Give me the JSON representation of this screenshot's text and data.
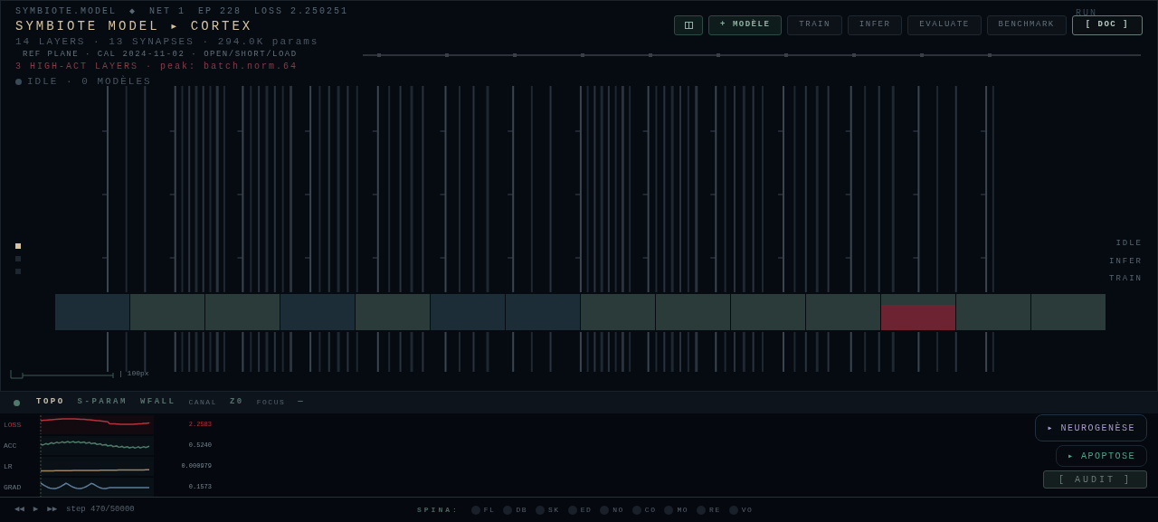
{
  "status_line": {
    "app": "SYMBIOTE.MODEL",
    "separator": "◆",
    "net": "NET 1",
    "epoch": "EP 228",
    "loss": "LOSS 2.250251"
  },
  "title": "SYMBIOTE MODEL ▸ CORTEX",
  "summary": "14 LAYERS · 13 SYNAPSES · 294.0K params",
  "reference": "REF PLANE · CAL 2024-11-02 · OPEN/SHORT/LOAD",
  "alert": "3 HIGH-ACT LAYERS · peak: batch.norm.64",
  "status": {
    "text": "IDLE · 0 MODÈLES"
  },
  "run_label": "RUN",
  "toolbar": [
    {
      "kind": "icon",
      "disabled": false
    },
    {
      "kind": "primary",
      "label": "+ MODÈLE",
      "disabled": false
    },
    {
      "kind": "button",
      "label": "TRAIN",
      "disabled": true
    },
    {
      "kind": "button",
      "label": "INFER",
      "disabled": true
    },
    {
      "kind": "button",
      "label": "EVALUATE",
      "disabled": true
    },
    {
      "kind": "button",
      "label": "BENCHMARK",
      "disabled": true
    },
    {
      "kind": "outline",
      "label": "[ DOC ]",
      "disabled": false
    }
  ],
  "layers": [
    {
      "color": "#1d2d38",
      "hot": false
    },
    {
      "color": "#2a3b39",
      "hot": false
    },
    {
      "color": "#2a3b39",
      "hot": false
    },
    {
      "color": "#1d2d38",
      "hot": false
    },
    {
      "color": "#2a3b39",
      "hot": false
    },
    {
      "color": "#1d2d38",
      "hot": false
    },
    {
      "color": "#1d2d38",
      "hot": false
    },
    {
      "color": "#2a3b39",
      "hot": false
    },
    {
      "color": "#2a3b39",
      "hot": false
    },
    {
      "color": "#2a3b39",
      "hot": false
    },
    {
      "color": "#2a3b39",
      "hot": false
    },
    {
      "color": "#2a3b39",
      "hot": true
    },
    {
      "color": "#2a3b39",
      "hot": false
    },
    {
      "color": "#2a3b39",
      "hot": false
    }
  ],
  "mode_indicators": [
    {
      "selected": true
    },
    {
      "selected": false
    },
    {
      "selected": false
    }
  ],
  "mode_labels": [
    "IDLE",
    "INFER",
    "TRAIN"
  ],
  "scale": "| 100px",
  "tabs": [
    {
      "label": "TOPO",
      "kind": "main",
      "selected": true
    },
    {
      "label": "S-PARAM",
      "kind": "main",
      "selected": false
    },
    {
      "label": "WFALL",
      "kind": "main",
      "selected": false
    },
    {
      "label": "CANAL",
      "kind": "minor",
      "selected": false
    },
    {
      "label": "Z0",
      "kind": "main",
      "selected": false
    },
    {
      "label": "FOCUS",
      "kind": "minor",
      "selected": false
    },
    {
      "label": "—",
      "kind": "main",
      "selected": false
    }
  ],
  "metrics": [
    {
      "label": "LOSS",
      "value": "2.2583",
      "color": "#b3333f",
      "highlight": true
    },
    {
      "label": "ACC",
      "value": "0.5240",
      "color": "#4f7a6a",
      "highlight": false
    },
    {
      "label": "LR",
      "value": "0.000979",
      "color": "#a08462",
      "highlight": false
    },
    {
      "label": "GRAD",
      "value": "0.1573",
      "color": "#5c7c99",
      "highlight": false
    }
  ],
  "actions": [
    {
      "label": "▸ NEUROGENÈSE",
      "color": "#a99ccf"
    },
    {
      "label": "▸ APOPTOSE",
      "color": "#4fa58a"
    },
    {
      "label": "[ AUDIT ]",
      "color": "#6c7a78"
    }
  ],
  "playback": {
    "controls": [
      "◀◀",
      "▶",
      "▶▶"
    ],
    "step": "step 470/50000"
  },
  "spina": {
    "label": "SPINA:",
    "items": [
      "FL",
      "DB",
      "SK",
      "ED",
      "NO",
      "CO",
      "MO",
      "RE",
      "VO"
    ]
  }
}
